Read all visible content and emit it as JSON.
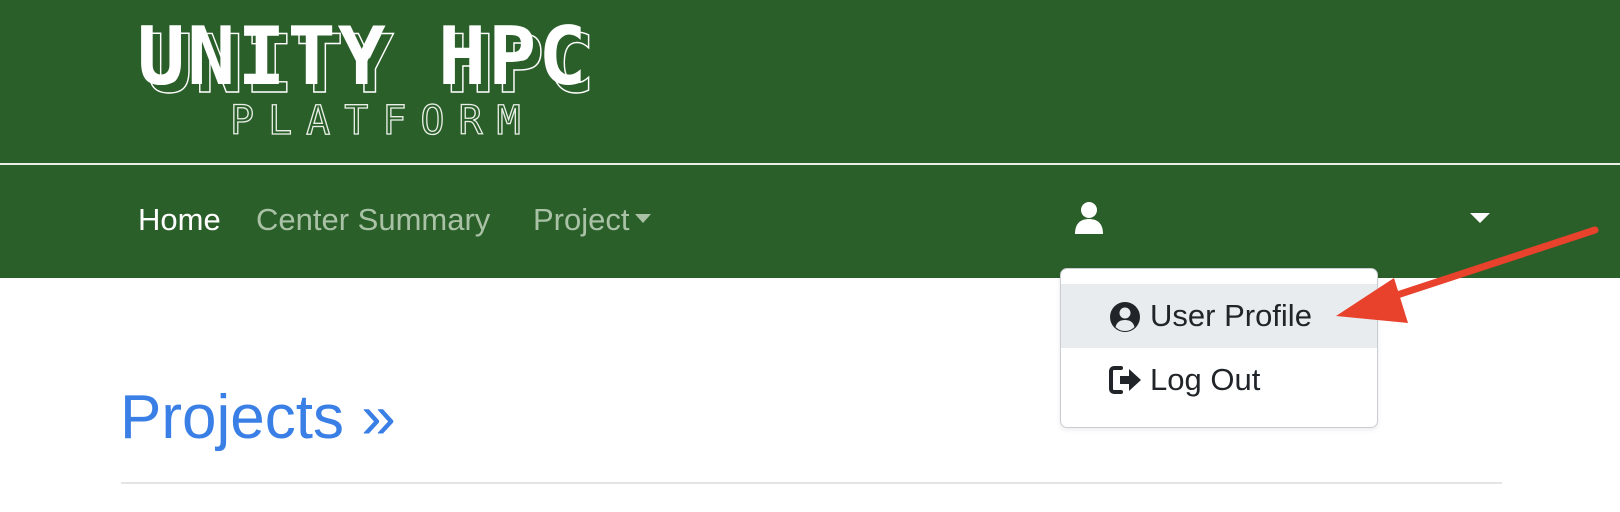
{
  "branding": {
    "logo_main": "UNITY HPC",
    "logo_sub": "PLATFORM",
    "banner_color": "#2b5f2a"
  },
  "nav": {
    "items": [
      {
        "label": "Home",
        "active": true
      },
      {
        "label": "Center Summary",
        "active": false
      },
      {
        "label": "Project",
        "active": false,
        "has_dropdown": true
      }
    ],
    "user": {
      "icon": "user-icon",
      "name": "",
      "name_obscured": true
    }
  },
  "user_menu": {
    "items": [
      {
        "label": "User Profile",
        "icon": "user-circle-icon",
        "highlighted": true
      },
      {
        "label": "Log Out",
        "icon": "sign-out-icon",
        "highlighted": false
      }
    ]
  },
  "main": {
    "title": "Projects »",
    "title_color": "#3a7fe6"
  },
  "annotation": {
    "arrow_color": "#e8412c",
    "points_to": "User Profile"
  }
}
